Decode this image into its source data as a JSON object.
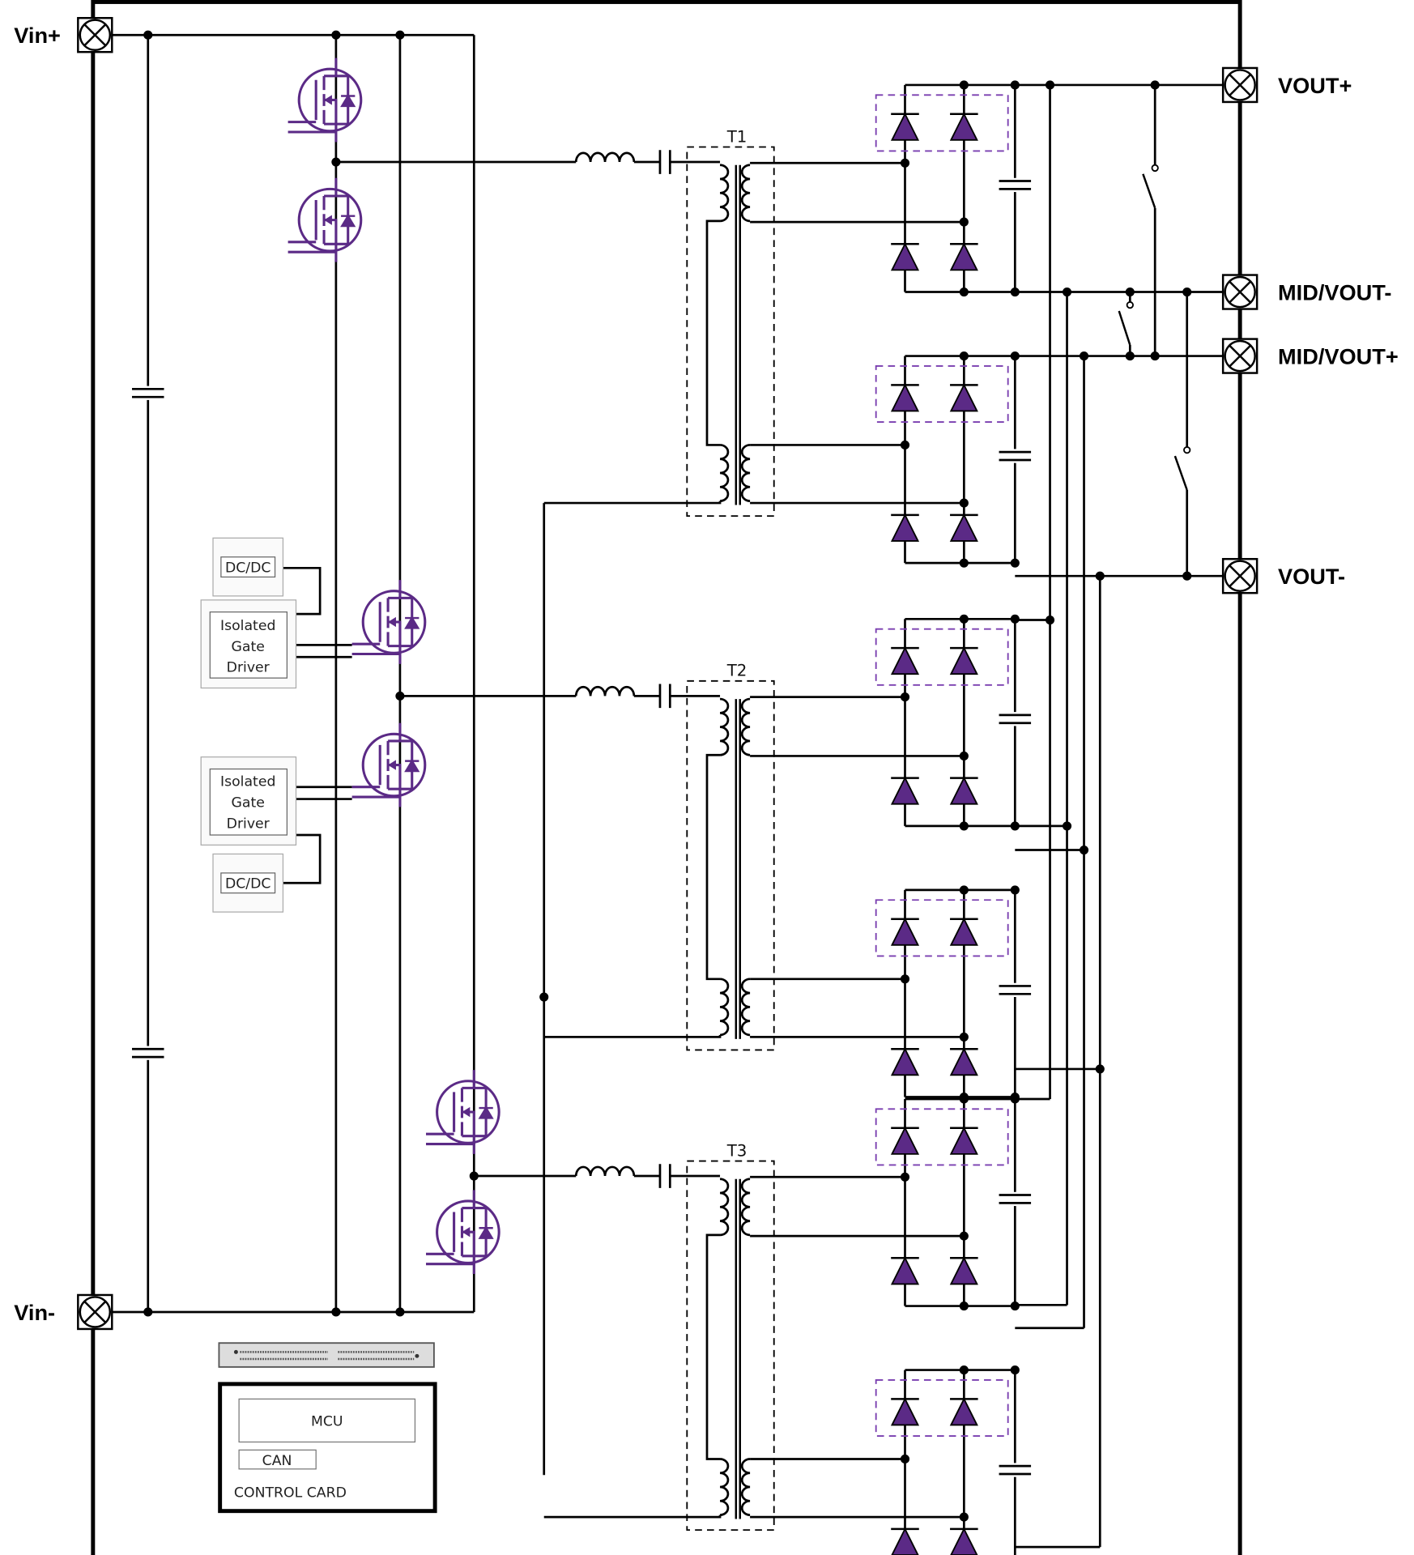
{
  "terminals": {
    "vin_plus": "Vin+",
    "vin_minus": "Vin-",
    "vout_plus": "VOUT+",
    "mid_vout_minus": "MID/VOUT-",
    "mid_vout_plus": "MID/VOUT+",
    "vout_minus": "VOUT-"
  },
  "transformers": [
    "T1",
    "T2",
    "T3"
  ],
  "gate_drivers": {
    "dcdc": "DC/DC",
    "driver_line1": "Isolated",
    "driver_line2": "Gate",
    "driver_line3": "Driver"
  },
  "control_card": {
    "mcu": "MCU",
    "can": "CAN",
    "title": "CONTROL CARD"
  },
  "colors": {
    "switch_purple": "#5b2a86",
    "wire": "#000000",
    "dashed_box_purple": "#7a3fb0"
  }
}
